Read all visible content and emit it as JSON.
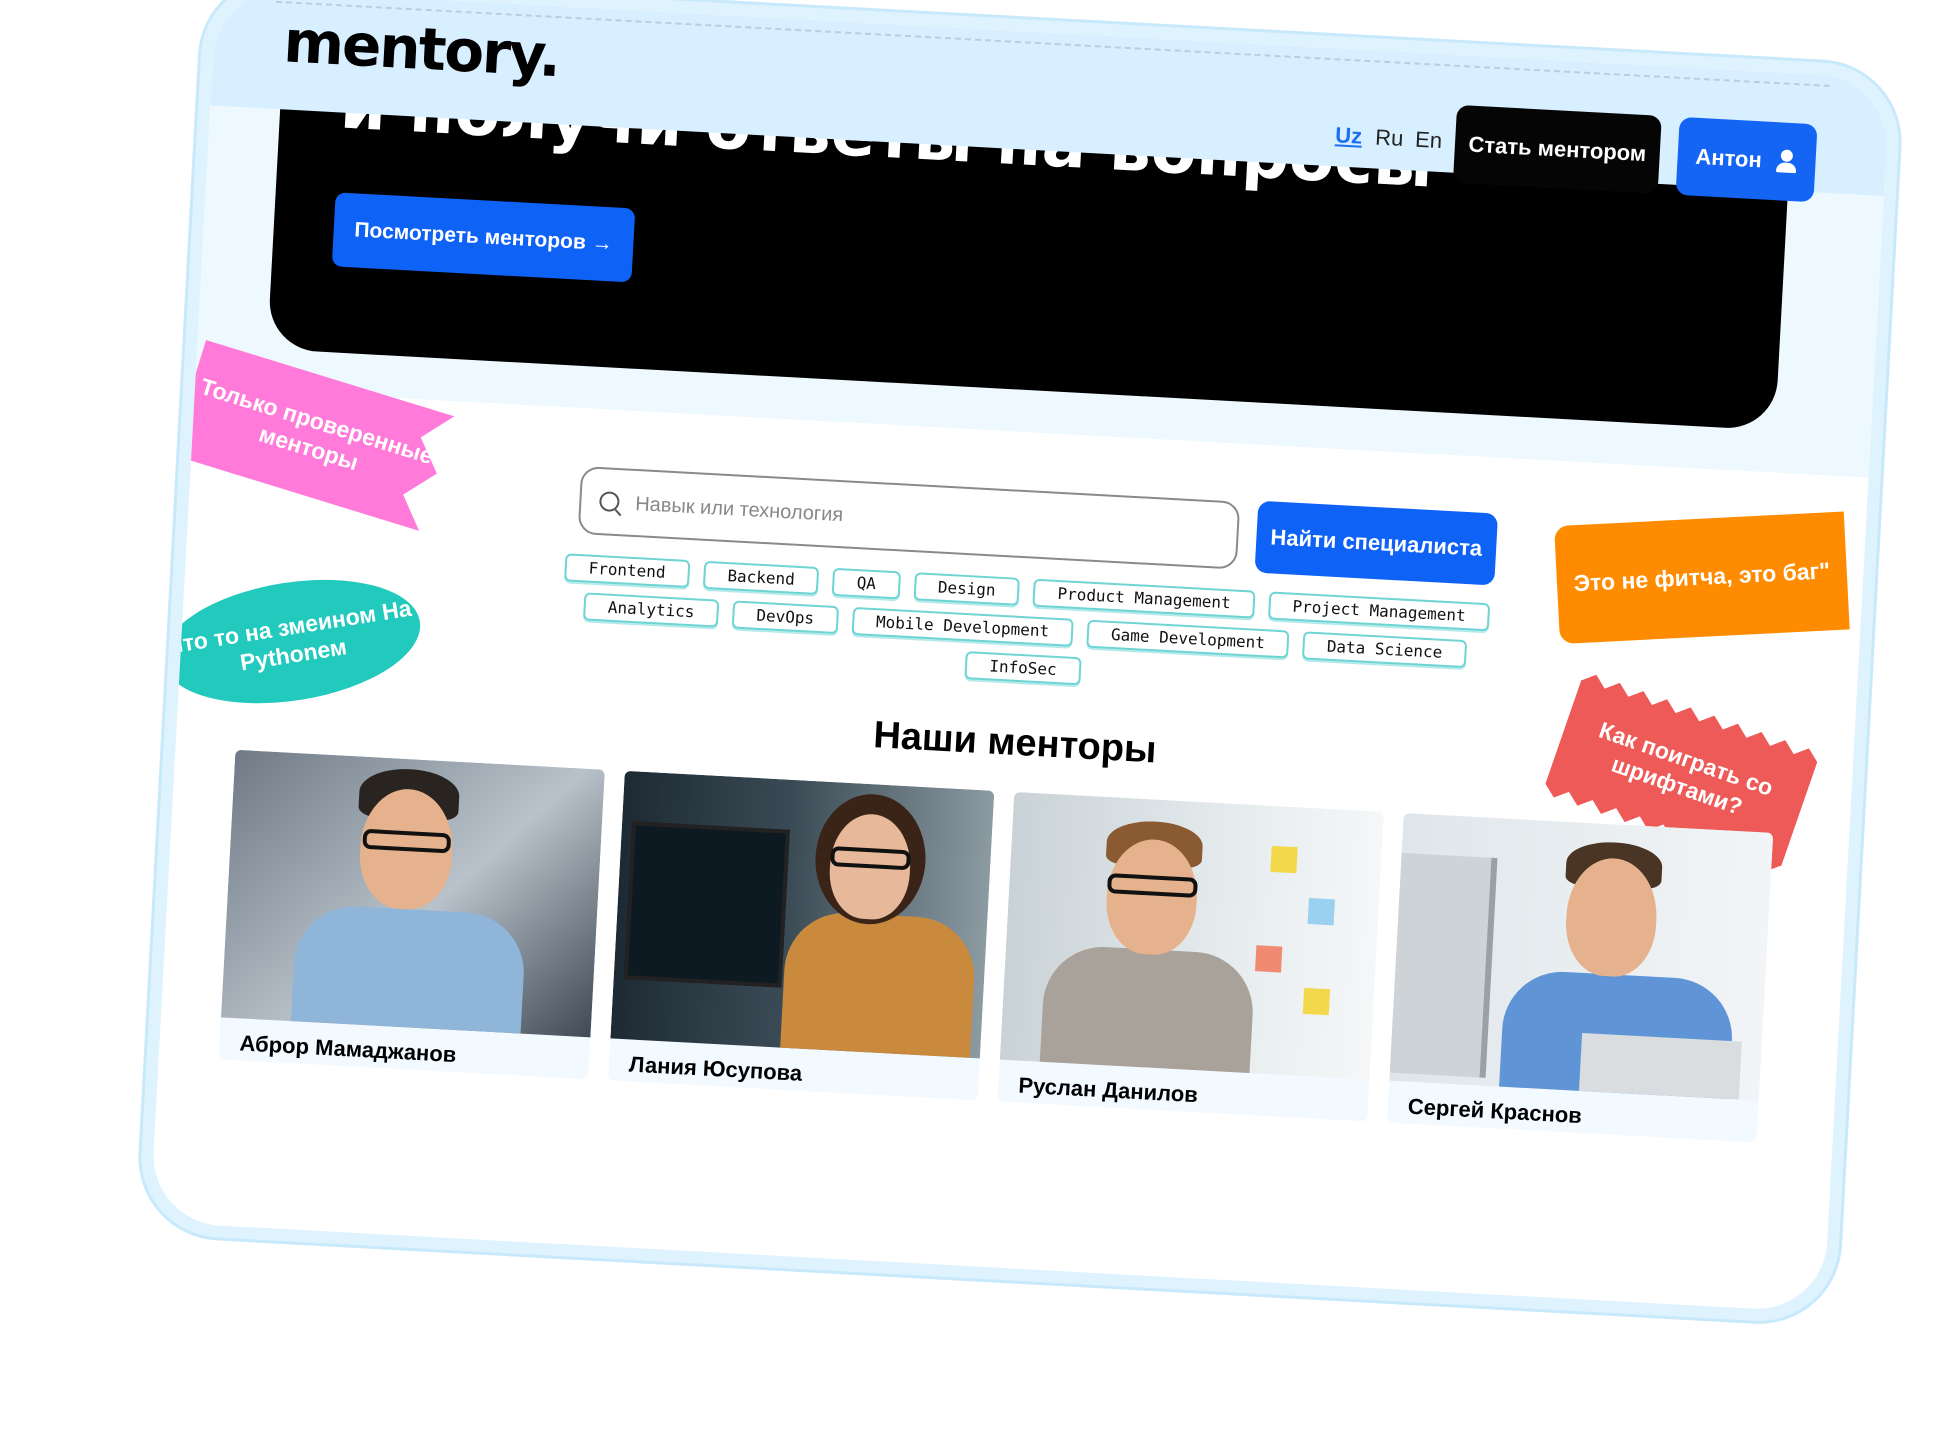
{
  "header": {
    "logo": "mentory.",
    "languages": [
      "Uz",
      "Ru",
      "En"
    ],
    "active_language": "Uz",
    "become_mentor": "Стать ментором",
    "user_name": "Антон"
  },
  "hero": {
    "text": "и получи ответы на вопросы",
    "cta": "Посмотреть менторов →"
  },
  "search": {
    "placeholder": "Навык или технология",
    "button": "Найти специалиста"
  },
  "tags": [
    "Frontend",
    "Backend",
    "QA",
    "Design",
    "Product Management",
    "Project Management",
    "Analytics",
    "DevOps",
    "Mobile Development",
    "Game Development",
    "Data Science",
    "InfoSec"
  ],
  "stickers": {
    "verified": "Только проверенные менторы",
    "python": "Что то на змеином На Pythonем",
    "bug": "Это не фитча, это баг\"",
    "fonts": "Как поиграть со шрифтами?"
  },
  "mentors": {
    "title": "Наши менторы",
    "items": [
      {
        "name": "Аброр Мамаджанов"
      },
      {
        "name": "Лания Юсупова"
      },
      {
        "name": "Руслан Данилов"
      },
      {
        "name": "Сергей Краснов"
      }
    ]
  },
  "colors": {
    "accent": "#1565f5",
    "header_bg": "#d7efff",
    "sticker_pink": "#ff7ad9",
    "sticker_teal": "#22c9bd",
    "sticker_orange": "#ff8c00",
    "sticker_red": "#ee5a57"
  }
}
